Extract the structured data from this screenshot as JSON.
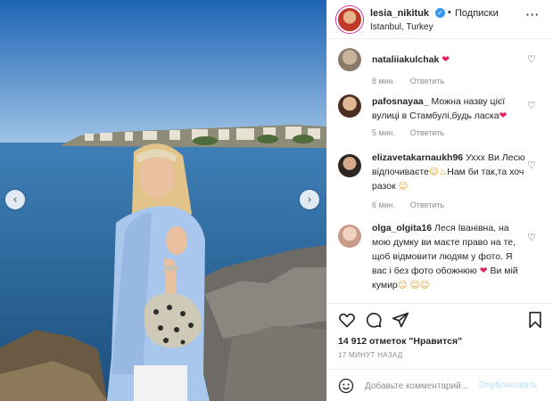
{
  "post": {
    "username": "lesia_nikituk",
    "follow_label": "Подписки",
    "location": "Istanbul, Turkey",
    "more_glyph": "···"
  },
  "comments": [
    {
      "user": "nataliiakulchak",
      "text": "",
      "time": "8 мин.",
      "reply": "Ответить",
      "avatar_color": "#8a7a6a"
    },
    {
      "user": "pafosnayaa_",
      "text": "Можна назву цієї вулиці в Стамбулі,будь ласка",
      "time": "5 мин.",
      "reply": "Ответить",
      "avatar_color": "#5a3a2a"
    },
    {
      "user": "elizavetakarnaukh96",
      "text": "Уххх Ви Лесю відпочиваєте",
      "text2": "Нам би так,та хоч разок",
      "time": "6 мин.",
      "reply": "Ответить",
      "avatar_color": "#3a2f2a"
    },
    {
      "user": "olga_olgita16",
      "text": "Леся Іванівна, на мою думку ви маєте право на те, щоб відмовити людям у фото. Я вас і без фото обожнюю",
      "text2": "Ви мій кумир",
      "time": "",
      "reply": "",
      "avatar_color": "#d8b8a8"
    }
  ],
  "actions": {
    "likes": "14 912 отметок \"Нравится\"",
    "time": "17 МИНУТ НАЗАД"
  },
  "add_comment": {
    "placeholder": "Добавьте комментарий...",
    "publish_label": "Опубликовать"
  },
  "icons": {
    "nav_left": "‹",
    "nav_right": "›",
    "heart": "♡",
    "verified": "✓"
  },
  "colors": {
    "accent": "#3897f0",
    "publish_disabled": "#b2dffc",
    "meta_gray": "#8e8e8e"
  }
}
